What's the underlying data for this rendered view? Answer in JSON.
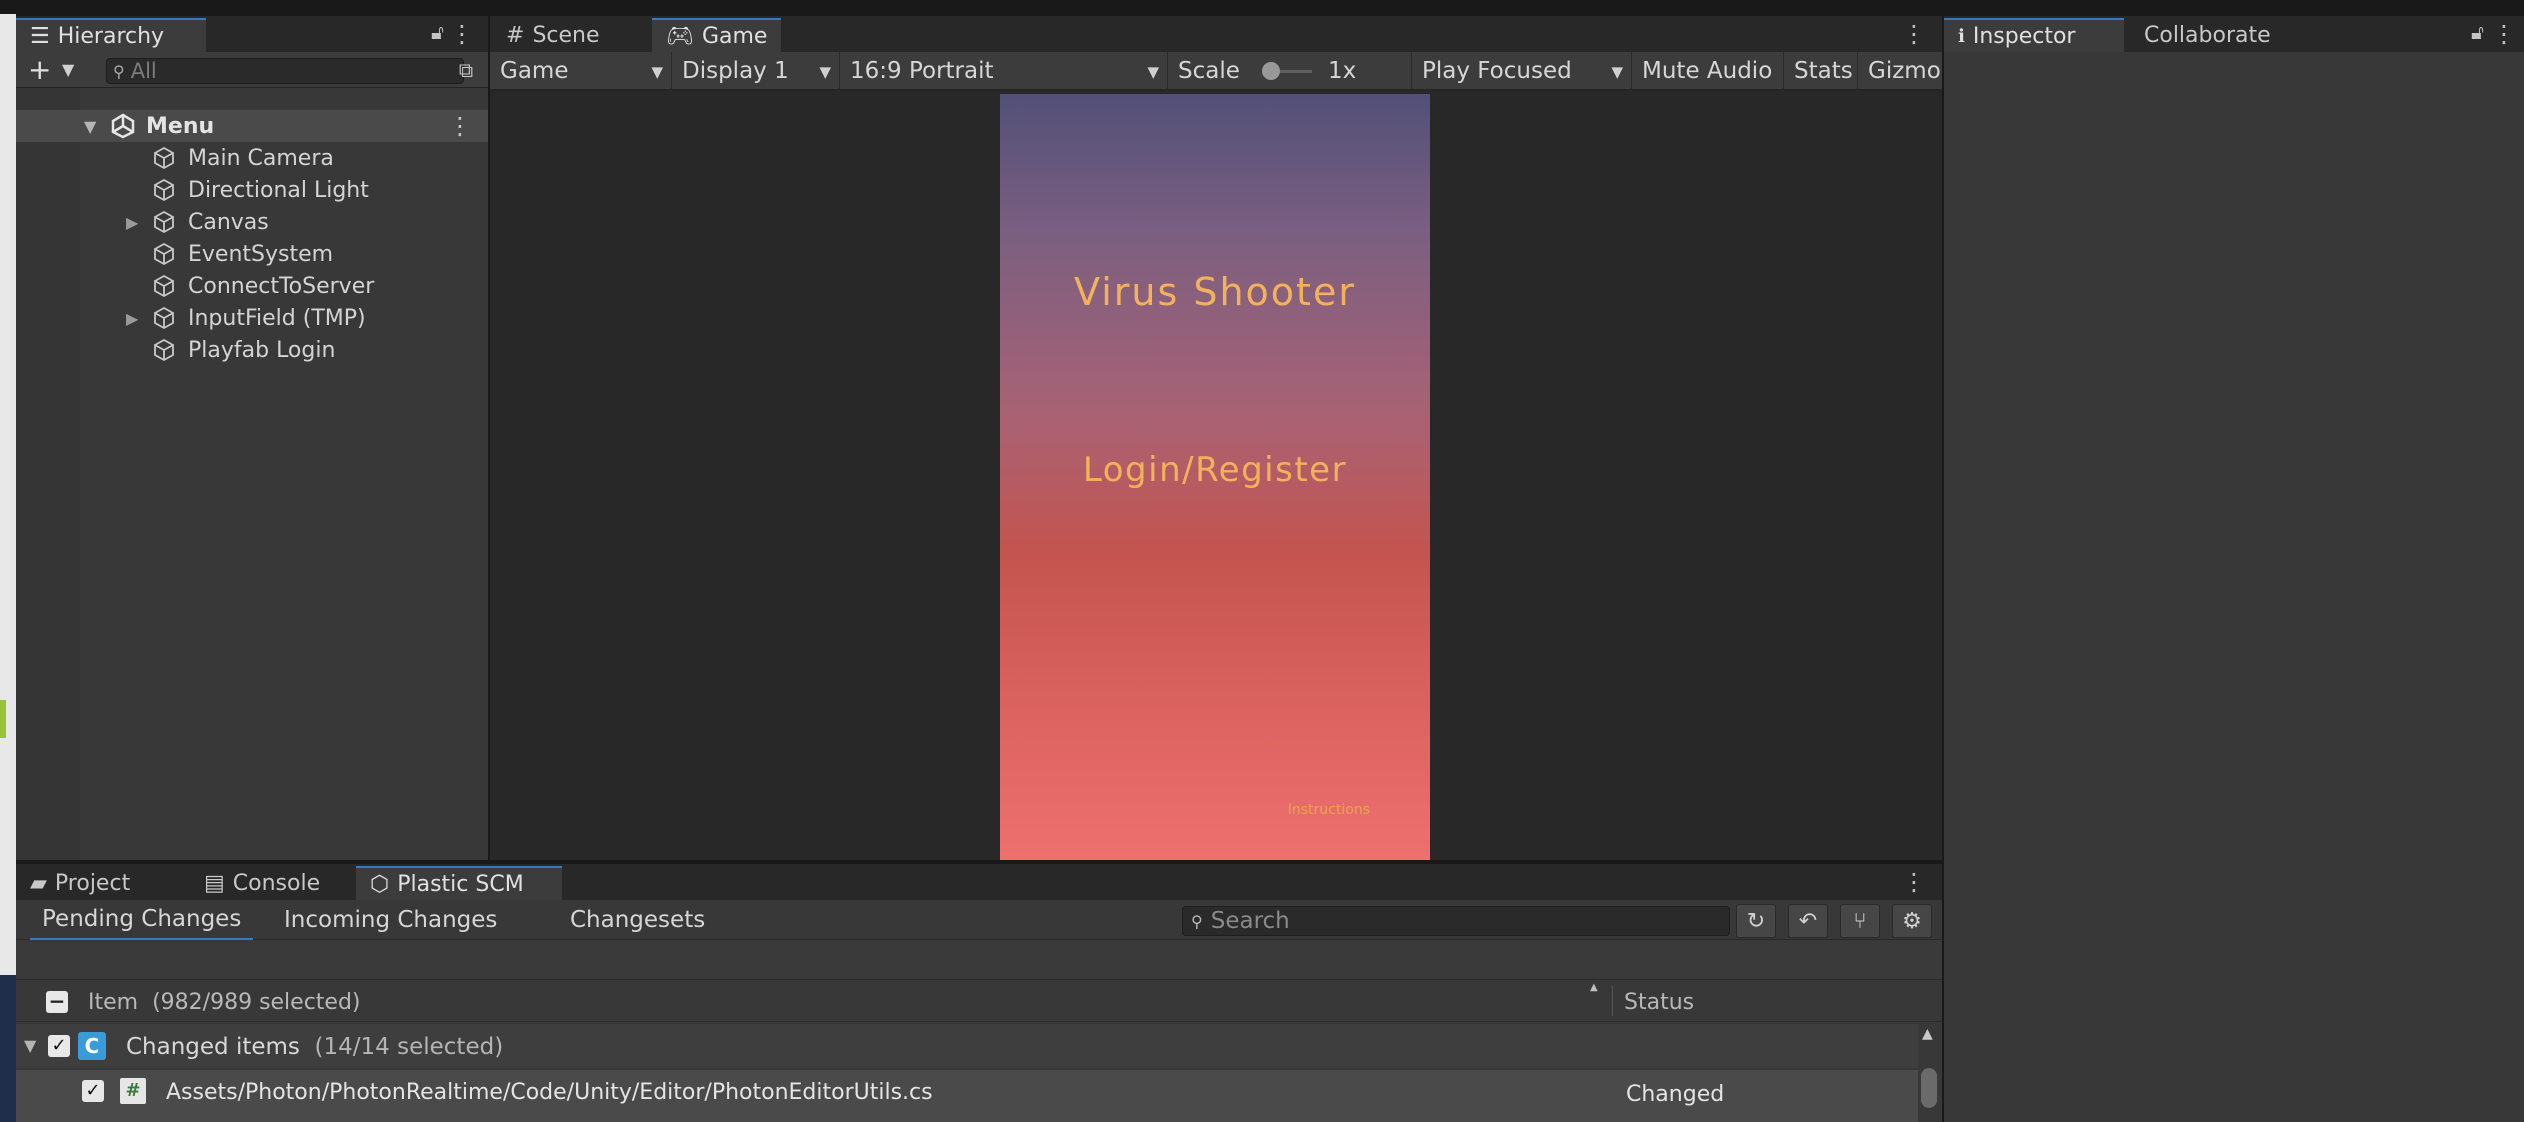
{
  "hierarchy": {
    "tab_label": "Hierarchy",
    "search_placeholder": "All",
    "scene_name": "Menu",
    "items": [
      {
        "label": "Main Camera",
        "expandable": false
      },
      {
        "label": "Directional Light",
        "expandable": false
      },
      {
        "label": "Canvas",
        "expandable": true
      },
      {
        "label": "EventSystem",
        "expandable": false
      },
      {
        "label": "ConnectToServer",
        "expandable": false
      },
      {
        "label": "InputField (TMP)",
        "expandable": true
      },
      {
        "label": "Playfab Login",
        "expandable": false
      }
    ]
  },
  "center_tabs": {
    "scene": "Scene",
    "game": "Game"
  },
  "game_toolbar": {
    "view_mode": "Game",
    "display": "Display 1",
    "aspect": "16:9 Portrait",
    "scale_label": "Scale",
    "scale_value": "1x",
    "play_mode": "Play Focused",
    "mute_audio": "Mute Audio",
    "stats": "Stats",
    "gizmos": "Gizmos"
  },
  "game_screen": {
    "title": "Virus Shooter",
    "login_button": "Login/Register",
    "instructions": "Instructions"
  },
  "right_tabs": {
    "inspector": "Inspector",
    "collaborate": "Collaborate"
  },
  "bottom_tabs": {
    "project": "Project",
    "console": "Console",
    "plastic": "Plastic SCM"
  },
  "plastic": {
    "subtabs": {
      "pending": "Pending Changes",
      "incoming": "Incoming Changes",
      "changesets": "Changesets"
    },
    "search_placeholder": "Search",
    "header": {
      "item": "Item",
      "selection": "(982/989 selected)",
      "status": "Status"
    },
    "group": {
      "badge": "C",
      "label": "Changed items",
      "selection": "(14/14 selected)"
    },
    "rows": [
      {
        "path": "Assets/Photon/PhotonRealtime/Code/Unity/Editor/PhotonEditorUtils.cs",
        "status": "Changed"
      }
    ]
  },
  "colors": {
    "accent": "#3a79bb",
    "title_text": "#f2b25c",
    "gradient_top": "#525078",
    "gradient_bottom": "#ee706e"
  }
}
